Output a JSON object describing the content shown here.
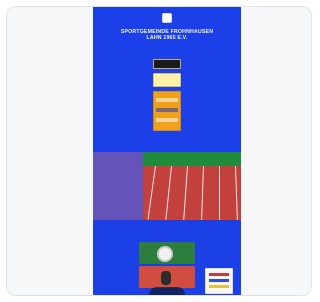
{
  "screenshot": {
    "title": "SPORTGEMEINDE FROHNHAUSEN\nLAHN 1965 e.V.",
    "middle_caption": "",
    "colors": {
      "frame_background": "#f6f7f9",
      "frame_border": "#dfe3e8",
      "site_blue": "#1a3fe6",
      "track_red": "#c2413c",
      "grass_green": "#1d8b3a"
    },
    "icons": {
      "logo": "club-logo-icon"
    }
  }
}
